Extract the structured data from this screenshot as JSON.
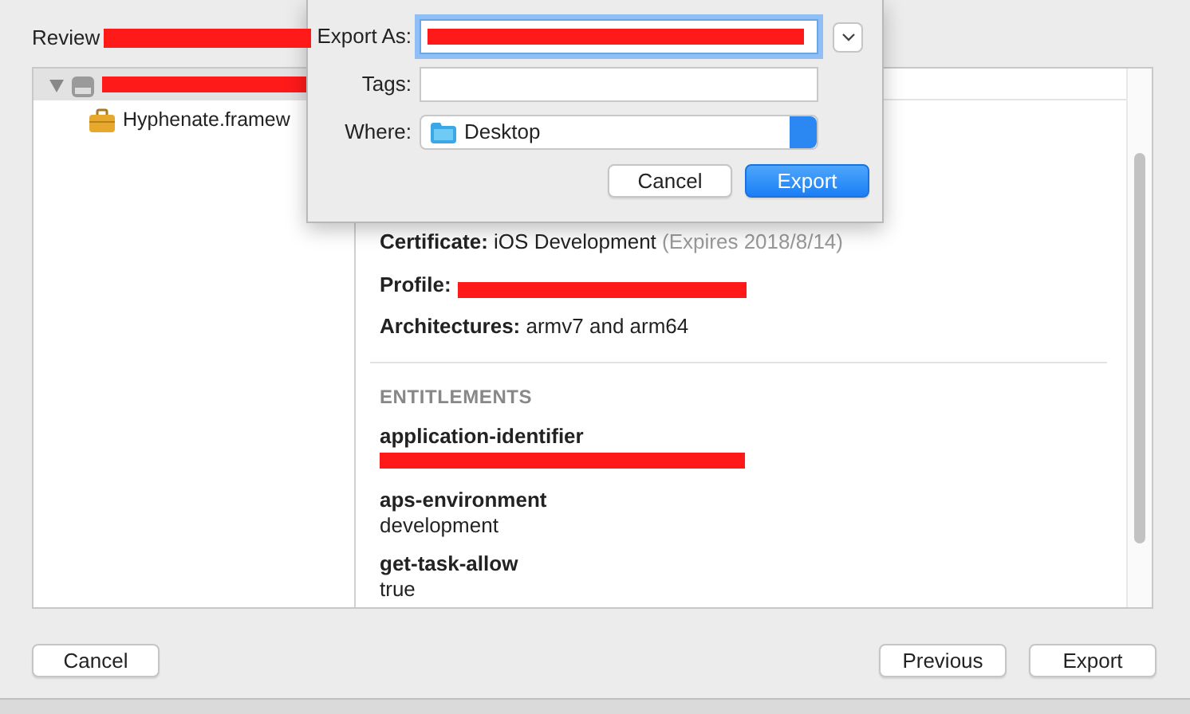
{
  "window": {
    "title": "Review"
  },
  "tree": [
    {
      "expanded": true,
      "selected": true,
      "children": [
        {
          "label": "Hyphenate.framew"
        }
      ]
    }
  ],
  "details": [
    {
      "label": "Certificate:",
      "value": "iOS Development",
      "note": "(Expires 2018/8/14)"
    },
    {
      "label": "Profile:"
    },
    {
      "label": "Architectures:",
      "value": "armv7 and arm64"
    }
  ],
  "section_title": "ENTITLEMENTS",
  "entitlements": [
    {
      "key": "application-identifier"
    },
    {
      "key": "aps-environment",
      "value": "development"
    },
    {
      "key": "get-task-allow",
      "value": "true"
    }
  ],
  "sheet": {
    "fields": [
      {
        "label": "Export As:",
        "kind": "text",
        "focused": true
      },
      {
        "label": "Tags:",
        "kind": "text",
        "focused": false
      },
      {
        "label": "Where:",
        "kind": "popup",
        "value": "Desktop"
      }
    ],
    "buttons": [
      {
        "label": "Cancel",
        "default": false
      },
      {
        "label": "Export",
        "default": true
      }
    ]
  },
  "footer": {
    "left_buttons": [
      "Cancel"
    ],
    "right_buttons": [
      "Previous",
      "Export"
    ]
  }
}
